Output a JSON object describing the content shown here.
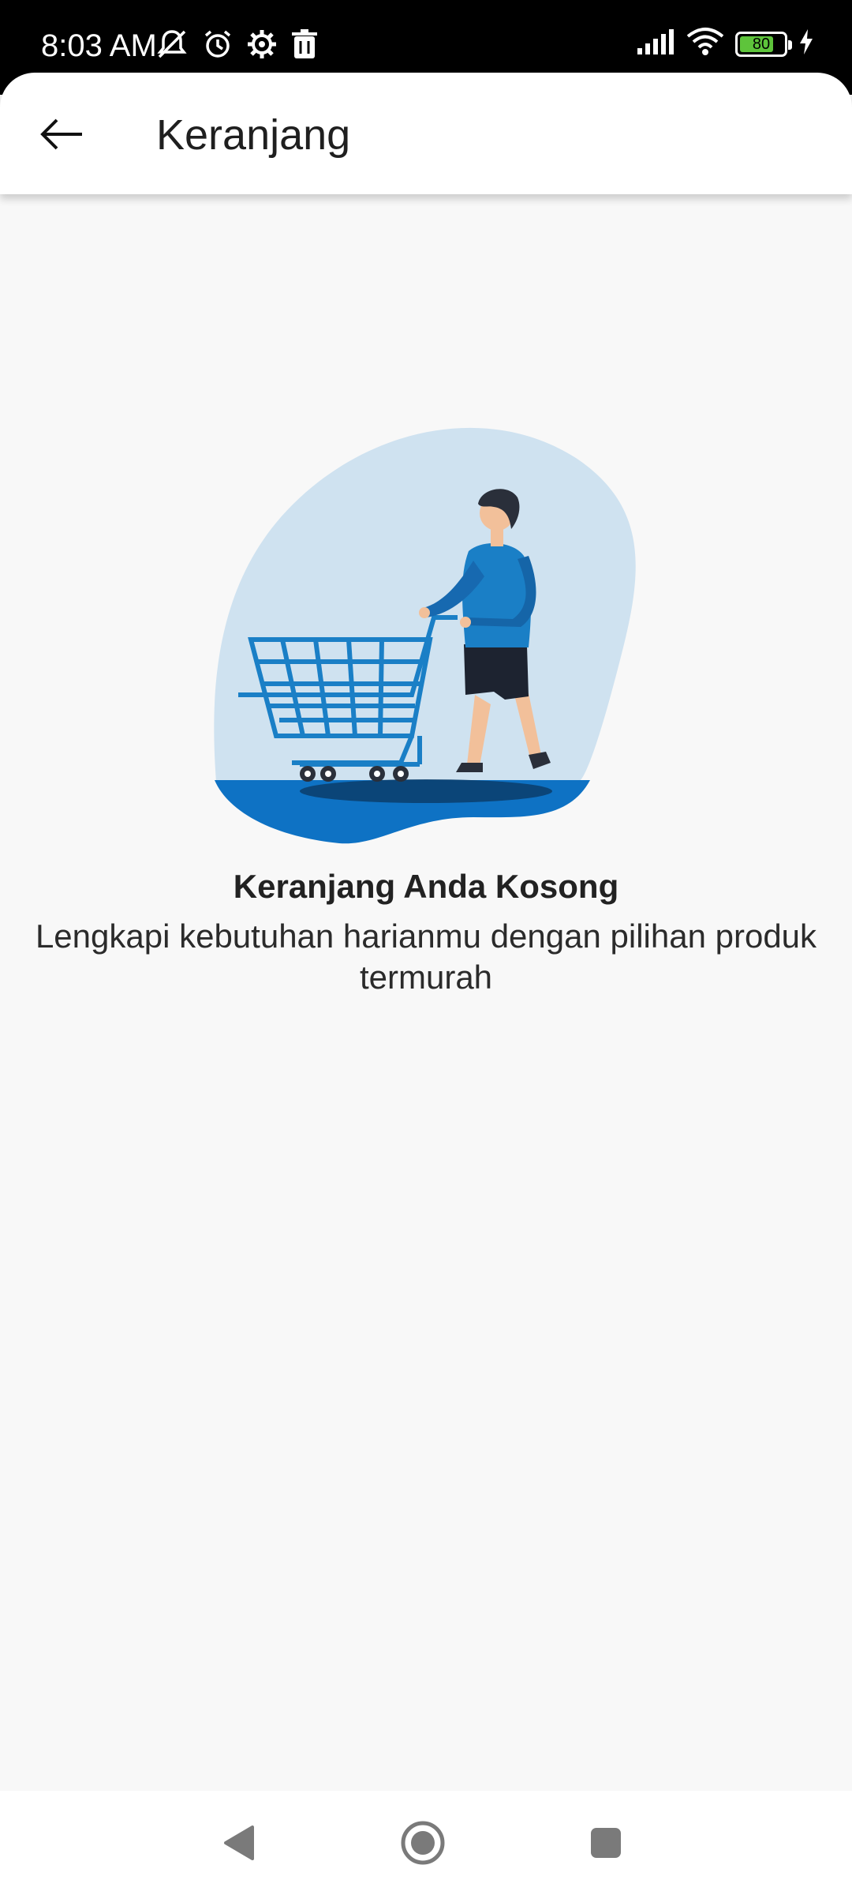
{
  "status_bar": {
    "time": "8:03 AM",
    "battery_level": "80",
    "battery_color": "#5ec43b",
    "left_icons": [
      "notifications-muted-icon",
      "alarm-icon",
      "settings-gear-icon",
      "trash-icon"
    ],
    "right_icons": [
      "signal-icon",
      "wifi-icon",
      "battery-icon",
      "charging-icon"
    ]
  },
  "header": {
    "title": "Keranjang",
    "back_icon": "arrow-left-icon"
  },
  "empty_state": {
    "title": "Keranjang Anda Kosong",
    "subtitle": "Lengkapi kebutuhan harianmu dengan pilihan produk termurah",
    "illustration": "person-pushing-shopping-cart",
    "accent_color": "#1a7fc6",
    "blob_color": "#cfe2f0"
  },
  "nav_bar": {
    "icons": [
      "back-triangle-icon",
      "home-circle-icon",
      "recents-square-icon"
    ]
  }
}
